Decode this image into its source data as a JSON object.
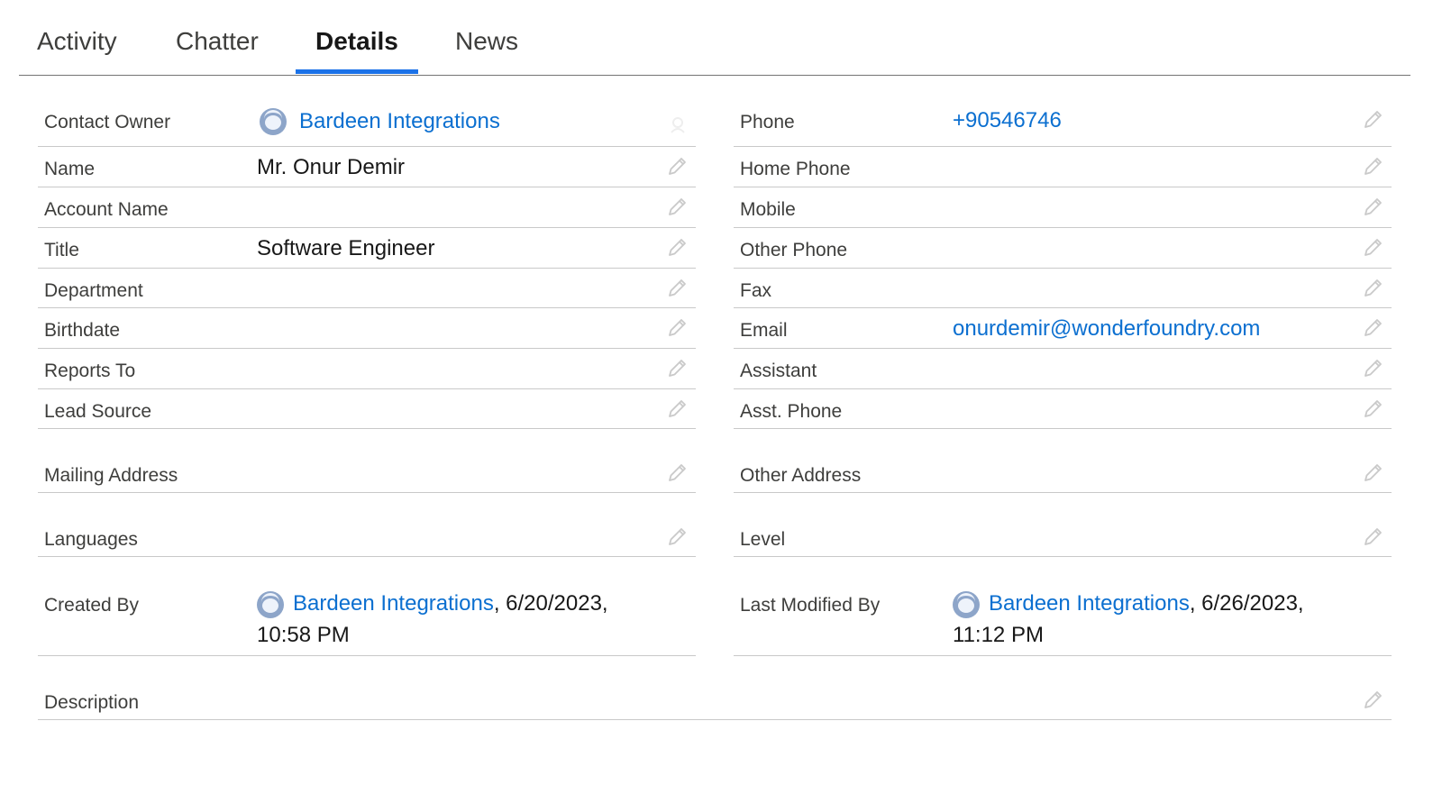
{
  "tabs": [
    "Activity",
    "Chatter",
    "Details",
    "News"
  ],
  "active_tab": "Details",
  "colors": {
    "accent": "#1b72e8",
    "link": "#0b6fd0",
    "avatar": "#8da5c9"
  },
  "fields": {
    "contact_owner": {
      "label": "Contact Owner",
      "value": "Bardeen Integrations"
    },
    "name": {
      "label": "Name",
      "value": "Mr. Onur Demir"
    },
    "account_name": {
      "label": "Account Name",
      "value": ""
    },
    "title": {
      "label": "Title",
      "value": "Software Engineer"
    },
    "department": {
      "label": "Department",
      "value": ""
    },
    "birthdate": {
      "label": "Birthdate",
      "value": ""
    },
    "reports_to": {
      "label": "Reports To",
      "value": ""
    },
    "lead_source": {
      "label": "Lead Source",
      "value": ""
    },
    "mailing_address": {
      "label": "Mailing Address",
      "value": ""
    },
    "languages": {
      "label": "Languages",
      "value": ""
    },
    "created_by": {
      "label": "Created By",
      "user": "Bardeen Integrations",
      "date": ", 6/20/2023,",
      "time": "10:58 PM"
    },
    "phone": {
      "label": "Phone",
      "value": "+90546746"
    },
    "home_phone": {
      "label": "Home Phone",
      "value": ""
    },
    "mobile": {
      "label": "Mobile",
      "value": ""
    },
    "other_phone": {
      "label": "Other Phone",
      "value": ""
    },
    "fax": {
      "label": "Fax",
      "value": ""
    },
    "email": {
      "label": "Email",
      "value": "onurdemir@wonderfoundry.com"
    },
    "assistant": {
      "label": "Assistant",
      "value": ""
    },
    "asst_phone": {
      "label": "Asst. Phone",
      "value": ""
    },
    "other_address": {
      "label": "Other Address",
      "value": ""
    },
    "level": {
      "label": "Level",
      "value": ""
    },
    "last_modified_by": {
      "label": "Last Modified By",
      "user": "Bardeen Integrations",
      "date": ", 6/26/2023,",
      "time": "11:12 PM"
    },
    "description": {
      "label": "Description",
      "value": ""
    }
  }
}
